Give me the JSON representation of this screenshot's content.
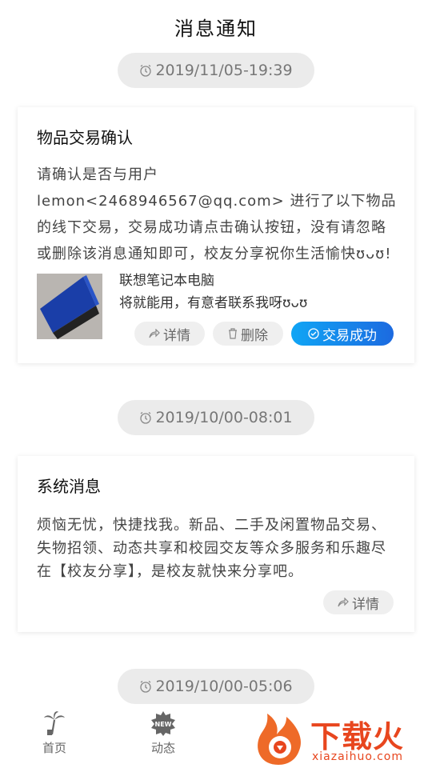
{
  "header": {
    "title": "消息通知"
  },
  "messages": [
    {
      "time": "2019/11/05-19:39",
      "title": "物品交易确认",
      "body": "请确认是否与用户 lemon<2468946567@qq.com> 进行了以下物品的线下交易，交易成功请点击确认按钮，没有请忽略或删除该消息通知即可，校友分享祝你生活愉快ʊᴗʊ!",
      "item_name": "联想笔记本电脑",
      "item_desc": "将就能用，有意者联系我呀ʊᴗʊ",
      "buttons": {
        "detail": "详情",
        "delete": "删除",
        "confirm": "交易成功"
      }
    },
    {
      "time": "2019/10/00-08:01",
      "title": "系统消息",
      "body": "烦恼无忧，快捷找我。新品、二手及闲置物品交易、失物招领、动态共享和校园交友等众多服务和乐趣尽在【校友分享】，是校友就快来分享吧。",
      "buttons": {
        "detail": "详情"
      }
    },
    {
      "time": "2019/10/00-05:06"
    }
  ],
  "tabbar": {
    "items": [
      {
        "label": "首页",
        "icon": "palm-tree-icon"
      },
      {
        "label": "动态",
        "icon": "new-badge-icon"
      }
    ]
  },
  "watermark": {
    "text": "下载火",
    "url": "xiazaihuo.com"
  },
  "colors": {
    "primary_gradient_start": "#10a5f5",
    "primary_gradient_end": "#1c6ae0",
    "pill_bg": "#ebebeb"
  }
}
